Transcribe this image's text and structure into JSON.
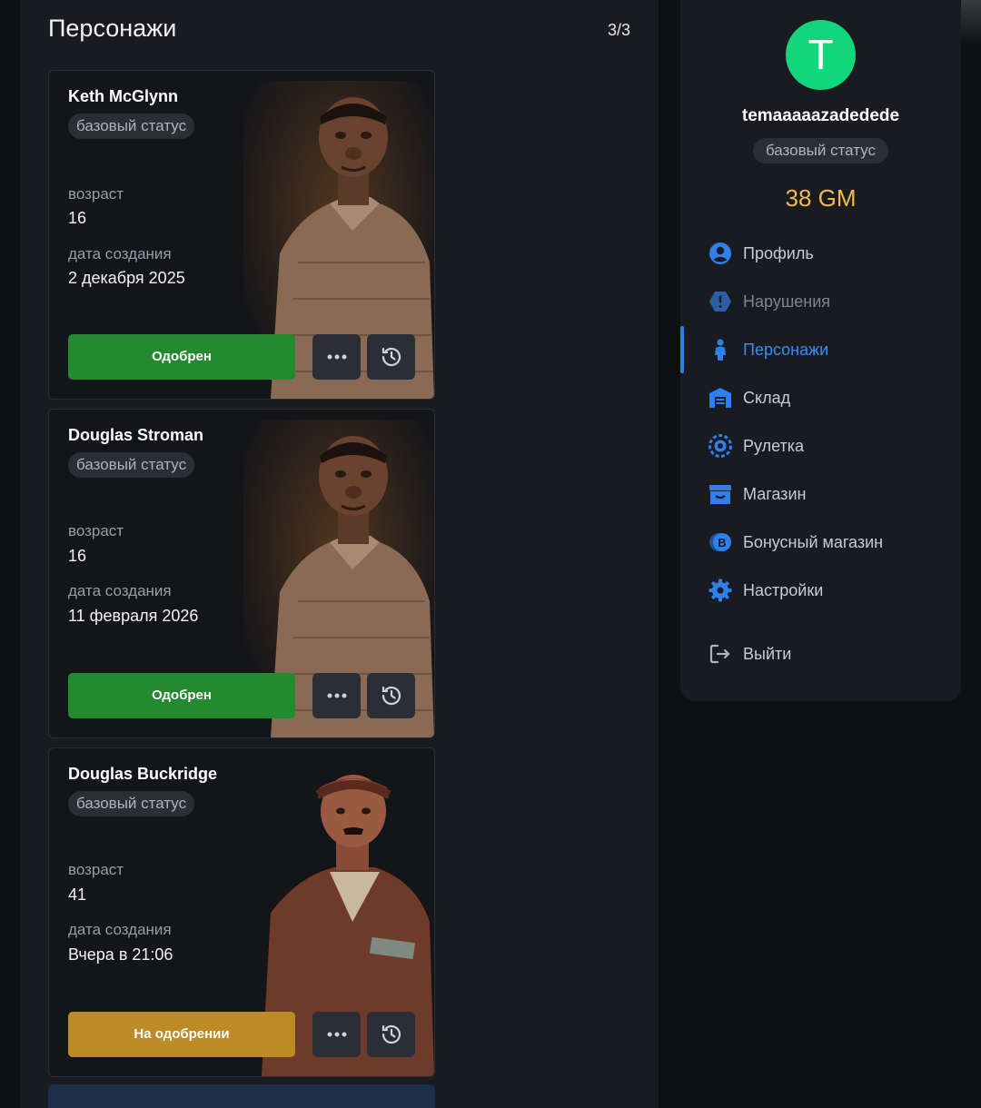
{
  "main": {
    "title": "Персонажи",
    "count": "3/3"
  },
  "characters": [
    {
      "name": "Keth McGlynn",
      "status_badge": "базовый статус",
      "age_label": "возраст",
      "age": "16",
      "created_label": "дата создания",
      "created": "2 декабря 2025",
      "state": "Одобрен",
      "state_color": "#238a2f"
    },
    {
      "name": "Douglas Stroman",
      "status_badge": "базовый статус",
      "age_label": "возраст",
      "age": "16",
      "created_label": "дата создания",
      "created": "11 февраля 2026",
      "state": "Одобрен",
      "state_color": "#238a2f"
    },
    {
      "name": "Douglas Buckridge",
      "status_badge": "базовый статус",
      "age_label": "возраст",
      "age": "41",
      "created_label": "дата создания",
      "created": "Вчера в 21:06",
      "state": "На одобрении",
      "state_color": "#be8a25"
    }
  ],
  "sidebar": {
    "avatar_letter": "T",
    "avatar_color": "#12d67b",
    "username": "temaaaaazadedede",
    "status_badge": "базовый статус",
    "balance": "38 GM",
    "balance_color": "#f3b948",
    "accent_color": "#2f80ed",
    "nav": [
      {
        "label": "Профиль",
        "icon": "user-circle-icon"
      },
      {
        "label": "Нарушения",
        "icon": "warning-hexagon-icon"
      },
      {
        "label": "Персонажи",
        "icon": "person-icon",
        "active": true
      },
      {
        "label": "Склад",
        "icon": "warehouse-icon"
      },
      {
        "label": "Рулетка",
        "icon": "roulette-icon"
      },
      {
        "label": "Магазин",
        "icon": "store-icon"
      },
      {
        "label": "Бонусный магазин",
        "icon": "bonus-coin-icon"
      },
      {
        "label": "Настройки",
        "icon": "gear-icon"
      },
      {
        "label": "Выйти",
        "icon": "logout-icon"
      }
    ]
  }
}
